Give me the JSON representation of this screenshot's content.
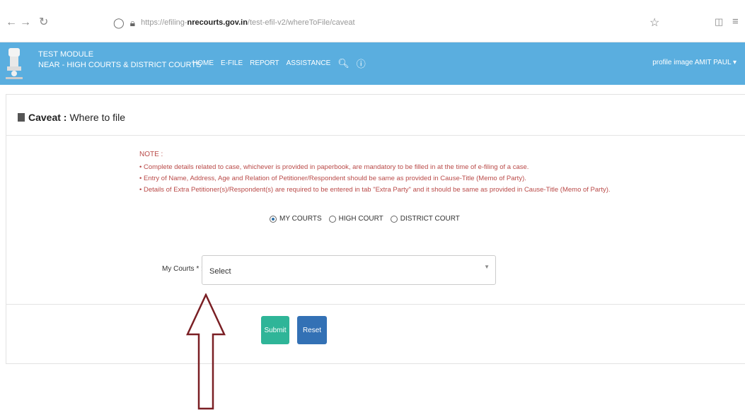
{
  "browser": {
    "url_prefix": "https://efiling-",
    "url_mid": "nrecourts.gov.in",
    "url_suffix": "/test-efil-v2/whereToFile/caveat"
  },
  "header": {
    "module_line1": "TEST MODULE",
    "module_line2": "NEAR - HIGH COURTS & DISTRICT COURTS",
    "nav": [
      "HOME",
      "E-FILE",
      "REPORT",
      "ASSISTANCE"
    ],
    "profile": "profile image AMIT PAUL ▾"
  },
  "page": {
    "title_bold": "Caveat :",
    "title_rest": "Where to file",
    "note_head": "NOTE :",
    "notes": [
      "Complete details related to case, whichever is provided in paperbook, are mandatory to be filled in at the time of e-filing of a case.",
      "Entry of Name, Address, Age and Relation of Petitioner/Respondent should be same as provided in Cause-Title (Memo of Party).",
      "Details of Extra Petitioner(s)/Respondent(s) are required to be entered in tab \"Extra Party\" and it should be same as provided in Cause-Title (Memo of Party)."
    ],
    "radio_options": [
      "MY COURTS",
      "HIGH COURT",
      "DISTRICT COURT"
    ],
    "courts_label": "My Courts * :",
    "select_value": "Select",
    "submit_label": "Submit",
    "reset_label": "Reset"
  },
  "colors": {
    "appbar": "#5aaedf",
    "note_text": "#b94a48",
    "submit": "#2fb598",
    "reset": "#3371b5",
    "arrow": "#7a1f24"
  }
}
